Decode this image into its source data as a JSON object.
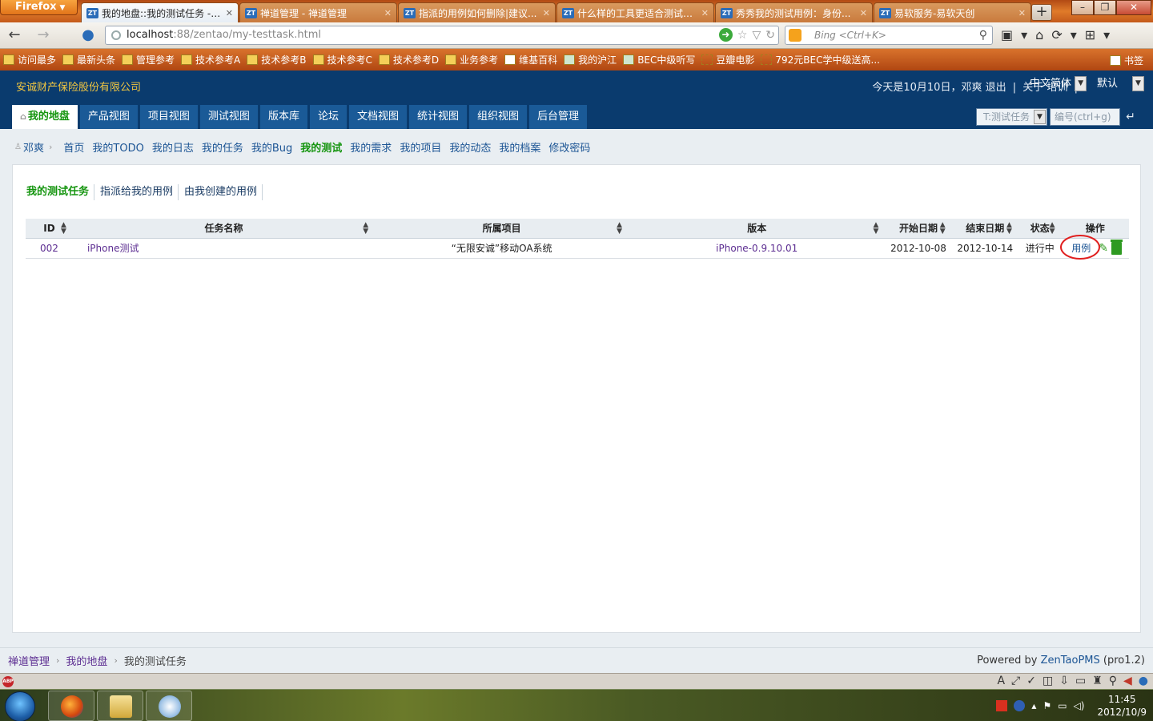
{
  "browser": {
    "app_button": "Firefox",
    "tabs": [
      {
        "title": "我的地盘::我的测试任务 - ...",
        "active": true
      },
      {
        "title": "禅道管理 - 禅道管理",
        "active": false
      },
      {
        "title": "指派的用例如何删除|建议...",
        "active": false
      },
      {
        "title": "什么样的工具更适合测试计...",
        "active": false
      },
      {
        "title": "秀秀我的测试用例：身份...",
        "active": false
      },
      {
        "title": "易软服务-易软天创",
        "active": false
      }
    ],
    "url_host": "localhost",
    "url_path": ":88/zentao/my-testtask.html",
    "search_placeholder": "Bing <Ctrl+K>",
    "bookmarks": [
      "访问最多",
      "最新头条",
      "管理参考",
      "技术参考A",
      "技术参考B",
      "技术参考C",
      "技术参考D",
      "业务参考",
      "维基百科",
      "我的沪江",
      "BEC中级听写",
      "豆瓣电影",
      "792元BEC学中级送高..."
    ],
    "bookmarks_menu": "书签",
    "favicon_text": "ZT"
  },
  "header": {
    "company": "安诚财产保险股份有限公司",
    "date_text": "今天是10月10日，",
    "user_name": "邓爽",
    "logout": "退出",
    "sep": "|",
    "about": "关于",
    "training": "培训",
    "language": "中文简体",
    "theme": "默认"
  },
  "mainnav": {
    "items": [
      "我的地盘",
      "产品视图",
      "项目视图",
      "测试视图",
      "版本库",
      "论坛",
      "文档视图",
      "统计视图",
      "组织视图",
      "后台管理"
    ],
    "active_index": 0
  },
  "search": {
    "type_value": "T:测试任务",
    "placeholder": "编号(ctrl+g)",
    "go_symbol": "↵"
  },
  "subnav": {
    "user": "邓爽",
    "items": [
      "首页",
      "我的TODO",
      "我的日志",
      "我的任务",
      "我的Bug",
      "我的测试",
      "我的需求",
      "我的项目",
      "我的动态",
      "我的档案",
      "修改密码"
    ],
    "active_index": 5
  },
  "subtabs": {
    "items": [
      "我的测试任务",
      "指派给我的用例",
      "由我创建的用例"
    ],
    "active_index": 0
  },
  "table": {
    "headers": [
      "ID",
      "任务名称",
      "所属项目",
      "版本",
      "开始日期",
      "结束日期",
      "状态",
      "操作"
    ],
    "rows": [
      {
        "id": "002",
        "name": "iPhone测试",
        "project": "“无限安诚”移动OA系统",
        "build": "iPhone-0.9.10.01",
        "begin": "2012-10-08",
        "end": "2012-10-14",
        "status": "进行中",
        "action_case": "用例"
      }
    ]
  },
  "footer": {
    "crumbs": [
      "禅道管理",
      "我的地盘",
      "我的测试任务"
    ],
    "powered_prefix": "Powered by",
    "powered_link": "ZenTaoPMS",
    "version": "(pro1.2)"
  },
  "taskbar": {
    "time": "11:45",
    "date": "2012/10/9"
  }
}
